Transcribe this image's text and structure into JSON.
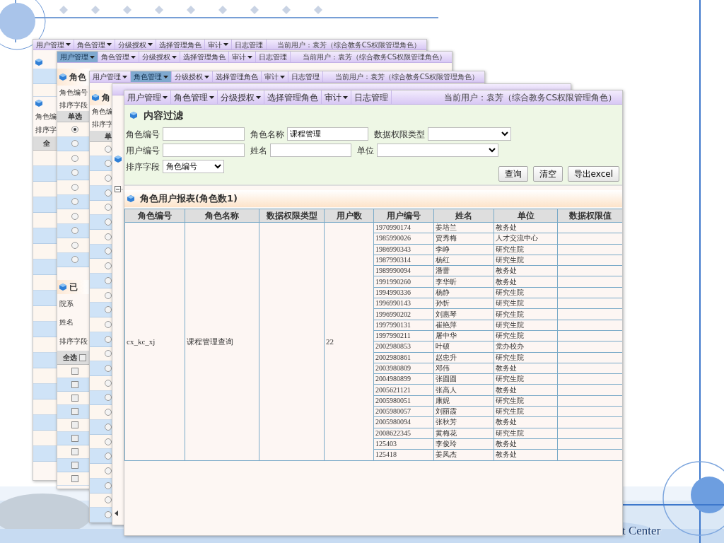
{
  "slide": {
    "footer_text": "t Center"
  },
  "window_1": {
    "menu": [
      {
        "label": "用户管理",
        "dropdown": true,
        "selected": false
      },
      {
        "label": "角色管理",
        "dropdown": true,
        "selected": false
      },
      {
        "label": "分级授权",
        "dropdown": true,
        "selected": false
      },
      {
        "label": "选择管理角色",
        "dropdown": false,
        "selected": false
      },
      {
        "label": "审计",
        "dropdown": true,
        "selected": false
      },
      {
        "label": "日志管理",
        "dropdown": false,
        "selected": false
      }
    ],
    "current_user": "当前用户：袁芳（综合教务CS权限管理角色）",
    "labels": [
      "角色编",
      "排序字"
    ],
    "table_header": "全"
  },
  "window_2": {
    "menu": [
      {
        "label": "用户管理",
        "dropdown": true,
        "selected": true
      },
      {
        "label": "角色管理",
        "dropdown": true,
        "selected": false
      },
      {
        "label": "分级授权",
        "dropdown": true,
        "selected": false
      },
      {
        "label": "选择管理角色",
        "dropdown": false,
        "selected": false
      },
      {
        "label": "审计",
        "dropdown": true,
        "selected": false
      },
      {
        "label": "日志管理",
        "dropdown": false,
        "selected": false
      }
    ],
    "current_user": "当前用户：袁芳（综合教务CS权限管理角色）",
    "section_title": "角色",
    "labels": [
      "角色编号",
      "排序字段"
    ],
    "radio_header": "单选",
    "radios": [
      {
        "selected": true
      },
      {
        "selected": false
      },
      {
        "selected": false
      },
      {
        "selected": false
      },
      {
        "selected": false
      },
      {
        "selected": false
      },
      {
        "selected": false
      },
      {
        "selected": false
      },
      {
        "selected": false
      },
      {
        "selected": false
      }
    ],
    "section_2_title": "已",
    "fields": [
      "院系",
      "姓名",
      "排序字段"
    ],
    "select_all": {
      "label": "全选",
      "checked": false
    },
    "checkboxes": [
      {
        "checked": false
      },
      {
        "checked": false
      },
      {
        "checked": false
      },
      {
        "checked": false
      },
      {
        "checked": false
      },
      {
        "checked": false
      },
      {
        "checked": false
      },
      {
        "checked": false
      },
      {
        "checked": false
      }
    ]
  },
  "window_3": {
    "menu": [
      {
        "label": "用户管理",
        "dropdown": true,
        "selected": false
      },
      {
        "label": "角色管理",
        "dropdown": true,
        "selected": true
      },
      {
        "label": "分级授权",
        "dropdown": true,
        "selected": false
      },
      {
        "label": "选择管理角色",
        "dropdown": false,
        "selected": false
      },
      {
        "label": "审计",
        "dropdown": true,
        "selected": false
      },
      {
        "label": "日志管理",
        "dropdown": false,
        "selected": false
      }
    ],
    "current_user": "当前用户：袁芳（综合教务CS权限管理角色）",
    "section_title": "角",
    "labels": [
      "角色编",
      "排序字"
    ],
    "radio_header": "单",
    "radios": [
      {
        "selected": false
      },
      {
        "selected": false
      },
      {
        "selected": false
      },
      {
        "selected": false
      },
      {
        "selected": false
      },
      {
        "selected": false
      },
      {
        "selected": false
      },
      {
        "selected": false
      },
      {
        "selected": false
      },
      {
        "selected": false
      },
      {
        "selected": false
      },
      {
        "selected": false
      },
      {
        "selected": false
      },
      {
        "selected": false
      },
      {
        "selected": false
      },
      {
        "selected": false
      },
      {
        "selected": false
      },
      {
        "selected": false
      },
      {
        "selected": false
      },
      {
        "selected": false
      },
      {
        "selected": false
      },
      {
        "selected": false
      },
      {
        "selected": false
      },
      {
        "selected": false
      },
      {
        "selected": false
      },
      {
        "selected": false
      }
    ]
  },
  "front_window": {
    "menu": [
      {
        "label": "用户管理",
        "dropdown": true,
        "selected": false
      },
      {
        "label": "角色管理",
        "dropdown": true,
        "selected": false
      },
      {
        "label": "分级授权",
        "dropdown": true,
        "selected": false
      },
      {
        "label": "选择管理角色",
        "dropdown": false,
        "selected": false
      },
      {
        "label": "审计",
        "dropdown": true,
        "selected": false
      },
      {
        "label": "日志管理",
        "dropdown": false,
        "selected": false
      }
    ],
    "current_user": "当前用户：袁芳（综合教务CS权限管理角色）",
    "filter": {
      "title": "内容过滤",
      "rows": [
        [
          {
            "label": "角色编号",
            "kind": "text"
          },
          {
            "label": "角色名称",
            "kind": "text",
            "value": "课程管理"
          },
          {
            "label": "数据权限类型",
            "kind": "select"
          }
        ],
        [
          {
            "label": "用户编号",
            "kind": "text"
          },
          {
            "label": "姓名",
            "kind": "text"
          },
          {
            "label": "单位",
            "kind": "select"
          }
        ],
        [
          {
            "label": "排序字段",
            "kind": "select",
            "value": "角色编号"
          }
        ]
      ],
      "buttons": [
        "查询",
        "清空",
        "导出excel"
      ]
    },
    "report": {
      "title": "角色用户报表(角色数1)",
      "columns": [
        "角色编号",
        "角色名称",
        "数据权限类型",
        "用户数",
        "用户编号",
        "姓名",
        "单位",
        "数据权限值"
      ],
      "role": {
        "code": "cx_kc_xj",
        "name": "课程管理查询",
        "user_count": "22"
      },
      "users": [
        {
          "code": "1970990174",
          "name": "姜培兰",
          "unit": "教务处"
        },
        {
          "code": "1985990026",
          "name": "贾秀梅",
          "unit": "人才交流中心"
        },
        {
          "code": "1986990343",
          "name": "李峥",
          "unit": "研究生院"
        },
        {
          "code": "1987990314",
          "name": "杨红",
          "unit": "研究生院"
        },
        {
          "code": "1989990094",
          "name": "潘蕾",
          "unit": "教务处"
        },
        {
          "code": "1991990260",
          "name": "李华昕",
          "unit": "教务处"
        },
        {
          "code": "1994990336",
          "name": "杨静",
          "unit": "研究生院"
        },
        {
          "code": "1996990143",
          "name": "孙忻",
          "unit": "研究生院"
        },
        {
          "code": "1996990202",
          "name": "刘惠琴",
          "unit": "研究生院"
        },
        {
          "code": "1997990131",
          "name": "崔艳萍",
          "unit": "研究生院"
        },
        {
          "code": "1997990211",
          "name": "屠中华",
          "unit": "研究生院"
        },
        {
          "code": "2002980853",
          "name": "叶硕",
          "unit": "党办校办"
        },
        {
          "code": "2002980861",
          "name": "赵忠升",
          "unit": "研究生院"
        },
        {
          "code": "2003980809",
          "name": "邓伟",
          "unit": "教务处"
        },
        {
          "code": "2004980899",
          "name": "张圆圆",
          "unit": "研究生院"
        },
        {
          "code": "2005621121",
          "name": "张高人",
          "unit": "教务处"
        },
        {
          "code": "2005980051",
          "name": "康妮",
          "unit": "研究生院"
        },
        {
          "code": "2005980057",
          "name": "刘丽霞",
          "unit": "研究生院"
        },
        {
          "code": "2005980094",
          "name": "张秋芳",
          "unit": "教务处"
        },
        {
          "code": "2008622345",
          "name": "黄梅花",
          "unit": "研究生院"
        },
        {
          "code": "125403",
          "name": "李俊玲",
          "unit": "教务处"
        },
        {
          "code": "125418",
          "name": "姜凤杰",
          "unit": "教务处"
        }
      ]
    }
  }
}
